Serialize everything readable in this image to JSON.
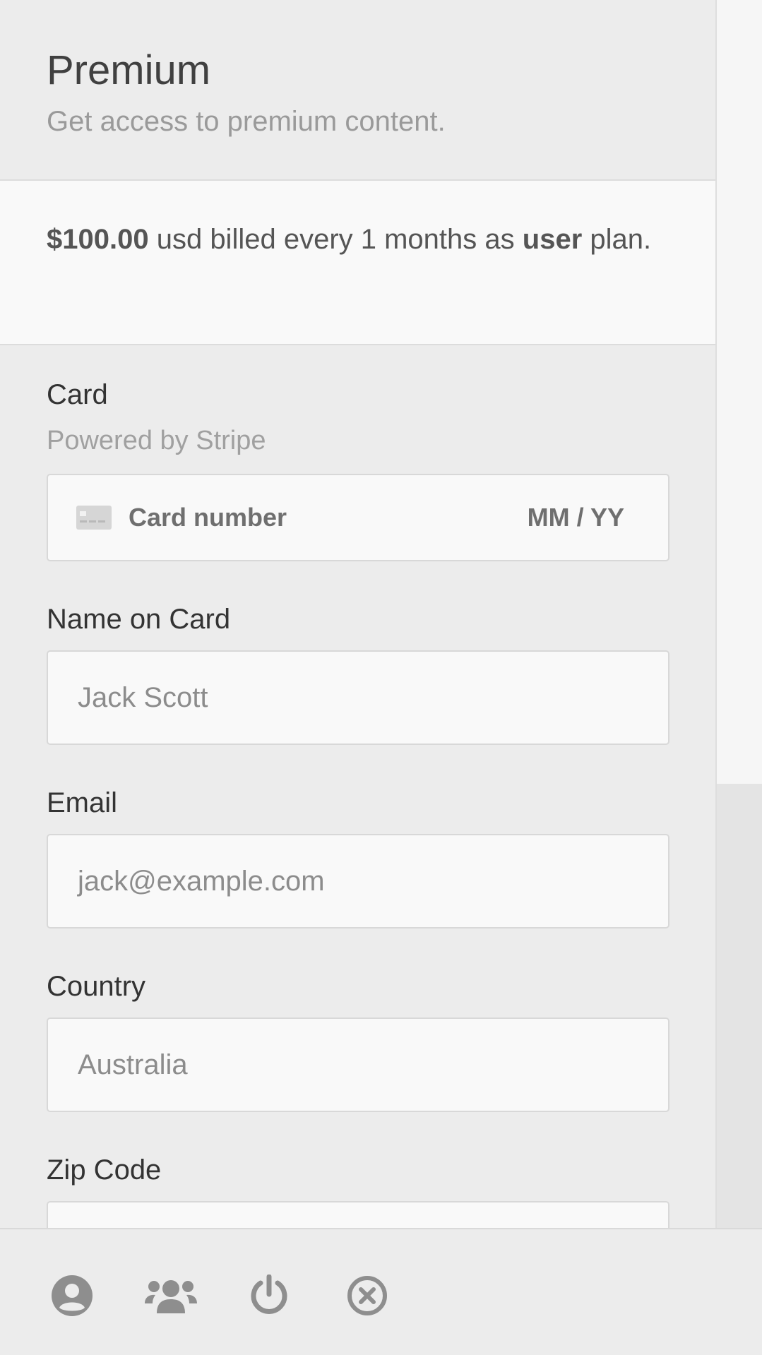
{
  "header": {
    "title": "Premium",
    "subtitle": "Get access to premium content."
  },
  "plan": {
    "price": "$100.00",
    "text_mid": " usd billed every 1 months as ",
    "plan_name": "user",
    "text_end": " plan."
  },
  "form": {
    "card": {
      "label": "Card",
      "hint": "Powered by Stripe",
      "number_placeholder": "Card number",
      "expiry_placeholder": "MM / YY"
    },
    "name": {
      "label": "Name on Card",
      "placeholder": "Jack Scott"
    },
    "email": {
      "label": "Email",
      "placeholder": "jack@example.com"
    },
    "country": {
      "label": "Country",
      "placeholder": "Australia"
    },
    "zip": {
      "label": "Zip Code",
      "placeholder": ""
    }
  },
  "bottom_nav": {
    "items": [
      {
        "icon": "user-circle-icon"
      },
      {
        "icon": "users-group-icon"
      },
      {
        "icon": "power-icon"
      },
      {
        "icon": "close-circle-icon"
      }
    ]
  },
  "colors": {
    "icon_gray": "#8e8e8e",
    "panel_bg": "#ececec",
    "plan_bg": "#f9f9f9"
  }
}
